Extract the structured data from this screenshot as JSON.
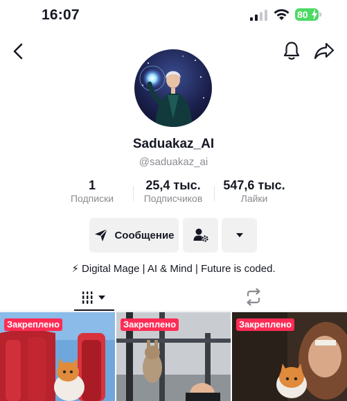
{
  "status_bar": {
    "time": "16:07",
    "battery": "80"
  },
  "profile": {
    "name": "Saduakaz_AI",
    "handle": "@saduakaz_ai",
    "bio": "⚡ Digital Mage | AI & Mind | Future is coded."
  },
  "stats": [
    {
      "value": "1",
      "label": "Подписки"
    },
    {
      "value": "25,4 тыс.",
      "label": "Подписчиков"
    },
    {
      "value": "547,6 тыс.",
      "label": "Лайки"
    }
  ],
  "actions": {
    "message_label": "Сообщение"
  },
  "videos": [
    {
      "badge": "Закреплено"
    },
    {
      "badge": "Закреплено"
    },
    {
      "badge": "Закреплено"
    }
  ],
  "colors": {
    "accent": "#fe2c55",
    "battery": "#4cd964",
    "text": "#161823",
    "muted": "#8a8b91"
  }
}
